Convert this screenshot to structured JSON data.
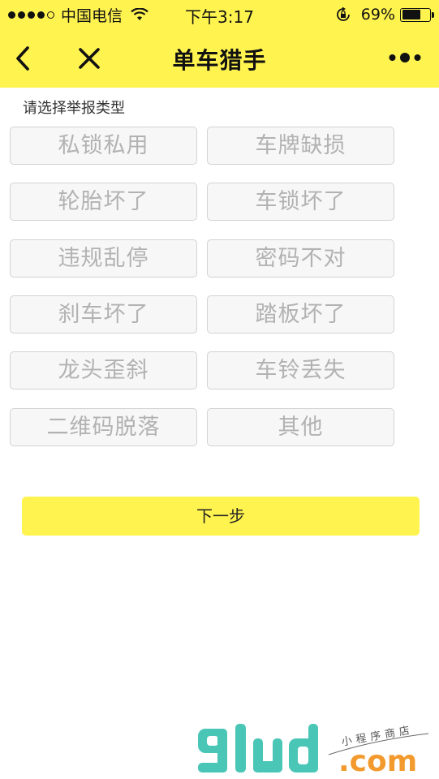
{
  "status_bar": {
    "carrier": "中国电信",
    "time": "下午3:17",
    "battery_percent": "69%",
    "battery_level": 0.69
  },
  "nav": {
    "title": "单车猎手",
    "back_icon": "chevron-left-icon",
    "close_icon": "close-icon",
    "more_icon": "more-dots-icon"
  },
  "content": {
    "section_label": "请选择举报类型",
    "report_types": [
      "私锁私用",
      "车牌缺损",
      "轮胎坏了",
      "车锁坏了",
      "违规乱停",
      "密码不对",
      "刹车坏了",
      "踏板坏了",
      "龙头歪斜",
      "车铃丢失",
      "二维码脱落",
      "其他"
    ],
    "next_label": "下一步"
  },
  "watermark": {
    "logo_text": "9lud",
    "tagline": "小程序商店",
    "suffix": ".com"
  },
  "colors": {
    "brand_yellow": "#fff34f",
    "button_border": "#d2d2d2",
    "button_text": "#b2b2b2",
    "watermark_teal": "#4ac6b7",
    "watermark_orange": "#f39a2e"
  }
}
